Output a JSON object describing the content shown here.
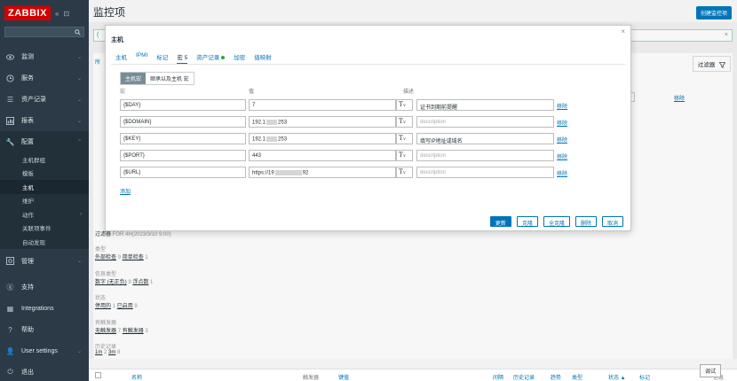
{
  "sidebar": {
    "logo": "ZABBIX",
    "collapse": "«",
    "kiosk": "⊡",
    "menu": [
      {
        "label": "监测",
        "icon": "eye-icon"
      },
      {
        "label": "服务",
        "icon": "clock-icon"
      },
      {
        "label": "资产记录",
        "icon": "list-icon"
      },
      {
        "label": "报表",
        "icon": "chart-icon"
      },
      {
        "label": "配置",
        "icon": "wrench-icon"
      }
    ],
    "submenu": [
      {
        "label": "主机群组"
      },
      {
        "label": "模板"
      },
      {
        "label": "主机"
      },
      {
        "label": "维护"
      },
      {
        "label": "动作"
      },
      {
        "label": "关联项事件"
      },
      {
        "label": "自动发现"
      }
    ],
    "manage": "管理",
    "bottom": [
      {
        "label": "支持",
        "icon": "support-icon"
      },
      {
        "label": "Integrations",
        "icon": "integrations-icon"
      },
      {
        "label": "帮助",
        "icon": "help-icon"
      },
      {
        "label": "User settings",
        "icon": "user-icon"
      },
      {
        "label": "退出",
        "icon": "power-icon"
      }
    ]
  },
  "page": {
    "title": "监控项",
    "create_button": "创建监控项",
    "filter": "过滤器",
    "remove": "移除",
    "bg_partial": "所",
    "bg_msg_partial": "(",
    "bg_time_label": "过滤器",
    "bg_time_value": "FOR 4H(2023/3/10 9:00)",
    "debug": "调试",
    "info_label": "信息"
  },
  "bg_filters": [
    {
      "title": "类型",
      "values": [
        {
          "text": "外部检查",
          "count": "9"
        },
        {
          "text": "简单检查",
          "count": "1"
        }
      ]
    },
    {
      "title": "信息类型",
      "values": [
        {
          "text": "数字 (无正负)",
          "count": "9"
        },
        {
          "text": "浮点数",
          "count": "1"
        }
      ]
    },
    {
      "title": "状态",
      "values": [
        {
          "text": "停用的",
          "count": "1"
        },
        {
          "text": "已启用",
          "count": "9"
        }
      ]
    },
    {
      "title": "有触发器",
      "values": [
        {
          "text": "无触发器",
          "count": "7"
        },
        {
          "text": "有触发器",
          "count": "3"
        }
      ]
    },
    {
      "title": "历史记录",
      "values": [
        {
          "text": "1m",
          "count": "2"
        },
        {
          "text": "3m",
          "count": "8"
        }
      ]
    }
  ],
  "table_head": [
    "名称",
    "触发器",
    "键值",
    "间隔",
    "历史记录",
    "趋势",
    "类型",
    "状态 ▲",
    "标记"
  ],
  "dialog": {
    "title": "主机",
    "tabs": [
      {
        "label": "主机"
      },
      {
        "label": "IPMI"
      },
      {
        "label": "标记"
      },
      {
        "label": "宏 5"
      },
      {
        "label": "资产记录"
      },
      {
        "label": "加密"
      },
      {
        "label": "值映射"
      }
    ],
    "radio": [
      "主机宏",
      "继承以及主机 宏"
    ],
    "col_macro": "宏",
    "col_value": "值",
    "col_desc": "描述",
    "rows": [
      {
        "macro": "{$DAY}",
        "value_a": "7",
        "value_b": "",
        "desc": "证书到期前提醒",
        "desc_ph": "description"
      },
      {
        "macro": "{$DOMAIN}",
        "value_a": "192.1",
        "value_b": "253",
        "desc": "",
        "desc_ph": "description"
      },
      {
        "macro": "{$KEY}",
        "value_a": "192.1",
        "value_b": "253",
        "desc": "填写IP地址或域名",
        "desc_ph": "description"
      },
      {
        "macro": "{$PORT}",
        "value_a": "443",
        "value_b": "",
        "desc": "",
        "desc_ph": "description"
      },
      {
        "macro": "{$URL}",
        "value_a": "https://19",
        "value_b": "92",
        "desc": "",
        "desc_ph": "description"
      }
    ],
    "type_symbol": "T",
    "type_caret": "∨",
    "remove": "移除",
    "add": "添加",
    "buttons": [
      "更新",
      "克隆",
      "全克隆",
      "删除",
      "取消"
    ]
  }
}
